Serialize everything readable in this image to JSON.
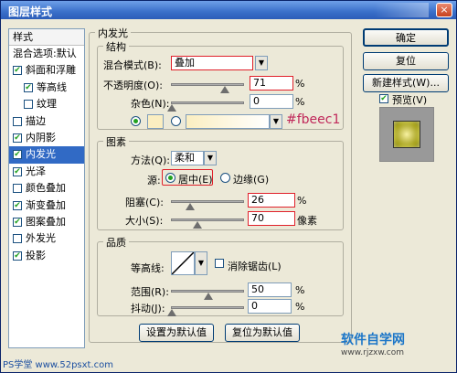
{
  "window": {
    "title": "图层样式",
    "close_glyph": "×"
  },
  "sidebar": {
    "header": "样式",
    "items": [
      {
        "label": "混合选项:默认",
        "checked": null,
        "indent": false,
        "selected": false
      },
      {
        "label": "斜面和浮雕",
        "checked": true,
        "indent": false,
        "selected": false
      },
      {
        "label": "等高线",
        "checked": true,
        "indent": true,
        "selected": false
      },
      {
        "label": "纹理",
        "checked": false,
        "indent": true,
        "selected": false
      },
      {
        "label": "描边",
        "checked": false,
        "indent": false,
        "selected": false
      },
      {
        "label": "内阴影",
        "checked": true,
        "indent": false,
        "selected": false
      },
      {
        "label": "内发光",
        "checked": true,
        "indent": false,
        "selected": true
      },
      {
        "label": "光泽",
        "checked": true,
        "indent": false,
        "selected": false
      },
      {
        "label": "颜色叠加",
        "checked": false,
        "indent": false,
        "selected": false
      },
      {
        "label": "渐变叠加",
        "checked": true,
        "indent": false,
        "selected": false
      },
      {
        "label": "图案叠加",
        "checked": true,
        "indent": false,
        "selected": false
      },
      {
        "label": "外发光",
        "checked": false,
        "indent": false,
        "selected": false
      },
      {
        "label": "投影",
        "checked": true,
        "indent": false,
        "selected": false
      }
    ]
  },
  "inner_glow": {
    "title": "内发光",
    "structure": {
      "title": "结构",
      "blend_mode_label": "混合模式(B):",
      "blend_mode_value": "叠加",
      "opacity_label": "不透明度(O):",
      "opacity_value": "71",
      "noise_label": "杂色(N):",
      "noise_value": "0",
      "percent": "%",
      "color_annotation": "#fbeec1",
      "glow_color": "#fbeec1"
    },
    "elements": {
      "title": "图素",
      "method_label": "方法(Q):",
      "method_value": "柔和",
      "source_label": "源:",
      "source_center": "居中(E)",
      "source_edge": "边缘(G)",
      "choke_label": "阻塞(C):",
      "choke_value": "26",
      "size_label": "大小(S):",
      "size_value": "70",
      "px_unit": "像素",
      "percent": "%"
    },
    "quality": {
      "title": "品质",
      "contour_label": "等高线:",
      "antialias_label": "消除锯齿(L)",
      "range_label": "范围(R):",
      "range_value": "50",
      "jitter_label": "抖动(J):",
      "jitter_value": "0",
      "percent": "%"
    },
    "buttons": {
      "set_default": "设置为默认值",
      "reset_default": "复位为默认值"
    }
  },
  "right_panel": {
    "ok": "确定",
    "reset": "复位",
    "new_style": "新建样式(W)...",
    "preview_label": "预览(V)",
    "preview_checked": true
  },
  "watermarks": {
    "left": "PS学堂 www.52psxt.com",
    "right_main": "软件自学网",
    "right_url": "www.rjzxw.com"
  },
  "colors": {
    "accent": "#316ac5",
    "highlight": "#e0202a",
    "annotation": "#c0285a"
  },
  "icons": {
    "dropdown": "chevron-down-icon",
    "checkbox": "checkmark-icon",
    "radio": "radio-icon"
  }
}
